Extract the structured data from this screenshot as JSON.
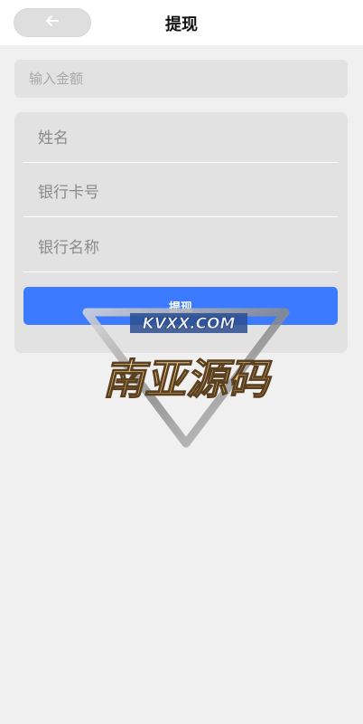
{
  "header": {
    "title": "提现",
    "back_icon": "arrow-left-icon"
  },
  "amount": {
    "placeholder": "输入金额",
    "value": ""
  },
  "form": {
    "name_placeholder": "姓名",
    "card_number_placeholder": "银行卡号",
    "bank_name_placeholder": "银行名称",
    "submit_label": "提现"
  },
  "watermark": {
    "url_text": "KVXX.COM",
    "brand_text": "南亚源码"
  },
  "colors": {
    "primary": "#3c7bff",
    "background": "#f0f0f0",
    "card": "#e2e2e2"
  }
}
